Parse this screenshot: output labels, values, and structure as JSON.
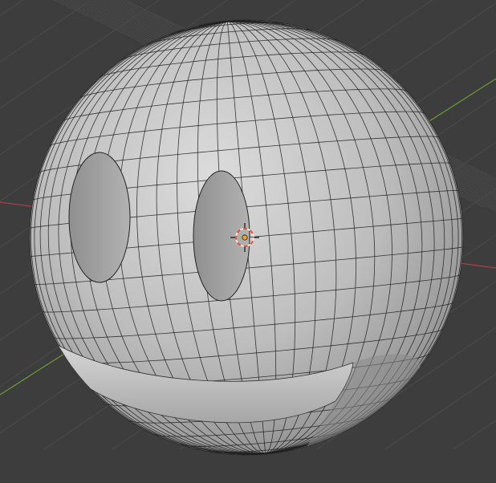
{
  "viewport": {
    "background_color": "#3d3d3d",
    "grid_color": "#4a4a4a",
    "x_axis_color": "#a8424a",
    "y_axis_color": "#6b9a34"
  },
  "object": {
    "type": "mesh",
    "shape": "sphere-with-eye-and-mouth-cutouts",
    "shading": "solid-gray",
    "wireframe_overlay": true,
    "surface_color": "#c9c9c9",
    "edge_color": "#1c1c1c"
  },
  "cursor": {
    "icon": "3d-cursor-icon",
    "ring_color": "#e8e8e8",
    "accent_color": "#e0542e",
    "origin_color": "#f0a020"
  }
}
